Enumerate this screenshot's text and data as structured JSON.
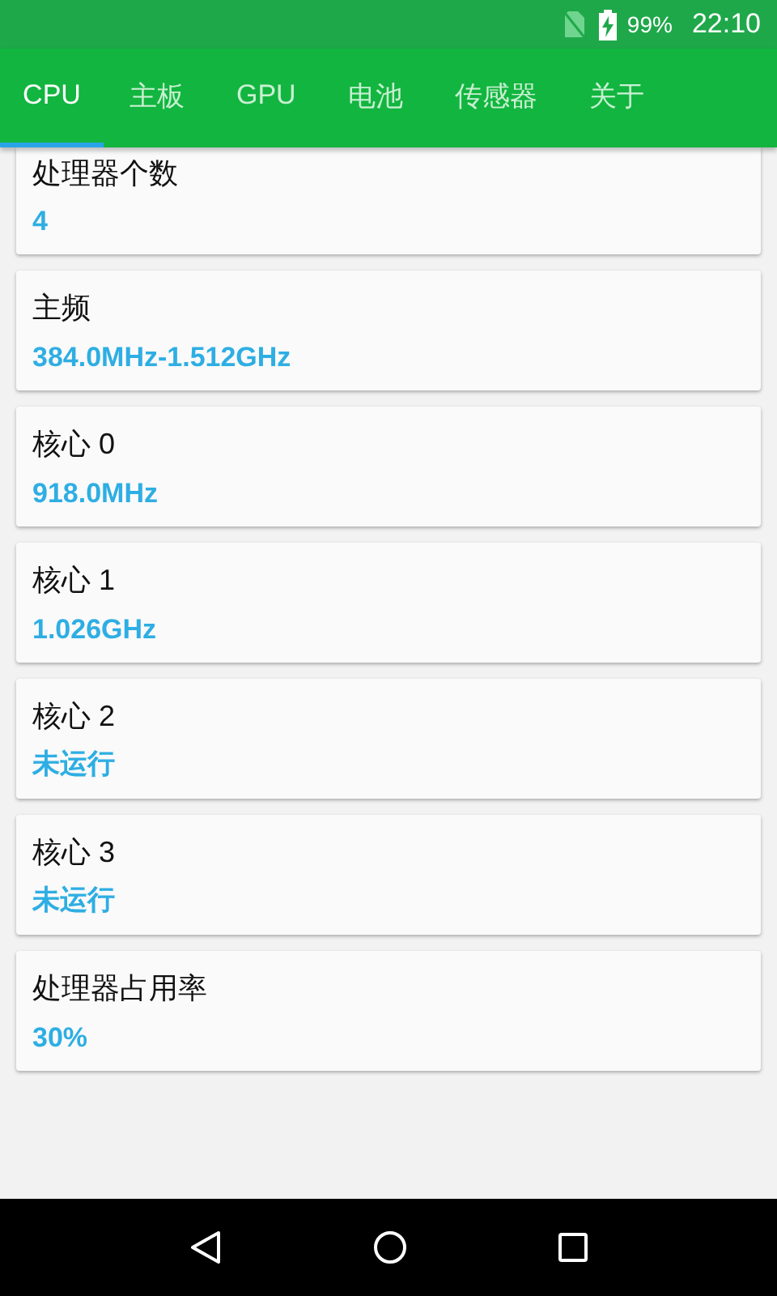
{
  "status_bar": {
    "battery": "99%",
    "time": "22:10"
  },
  "tabs": [
    {
      "label": "CPU",
      "selected": true
    },
    {
      "label": "主板",
      "selected": false
    },
    {
      "label": "GPU",
      "selected": false
    },
    {
      "label": "电池",
      "selected": false
    },
    {
      "label": "传感器",
      "selected": false
    },
    {
      "label": "关于",
      "selected": false
    }
  ],
  "cards": [
    {
      "title": "处理器个数",
      "value": "4"
    },
    {
      "title": "主频",
      "value": "384.0MHz-1.512GHz"
    },
    {
      "title": "核心 0",
      "value": "918.0MHz"
    },
    {
      "title": "核心 1",
      "value": "1.026GHz"
    },
    {
      "title": "核心 2",
      "value": "未运行"
    },
    {
      "title": "核心 3",
      "value": "未运行"
    },
    {
      "title": "处理器占用率",
      "value": "30%"
    }
  ]
}
